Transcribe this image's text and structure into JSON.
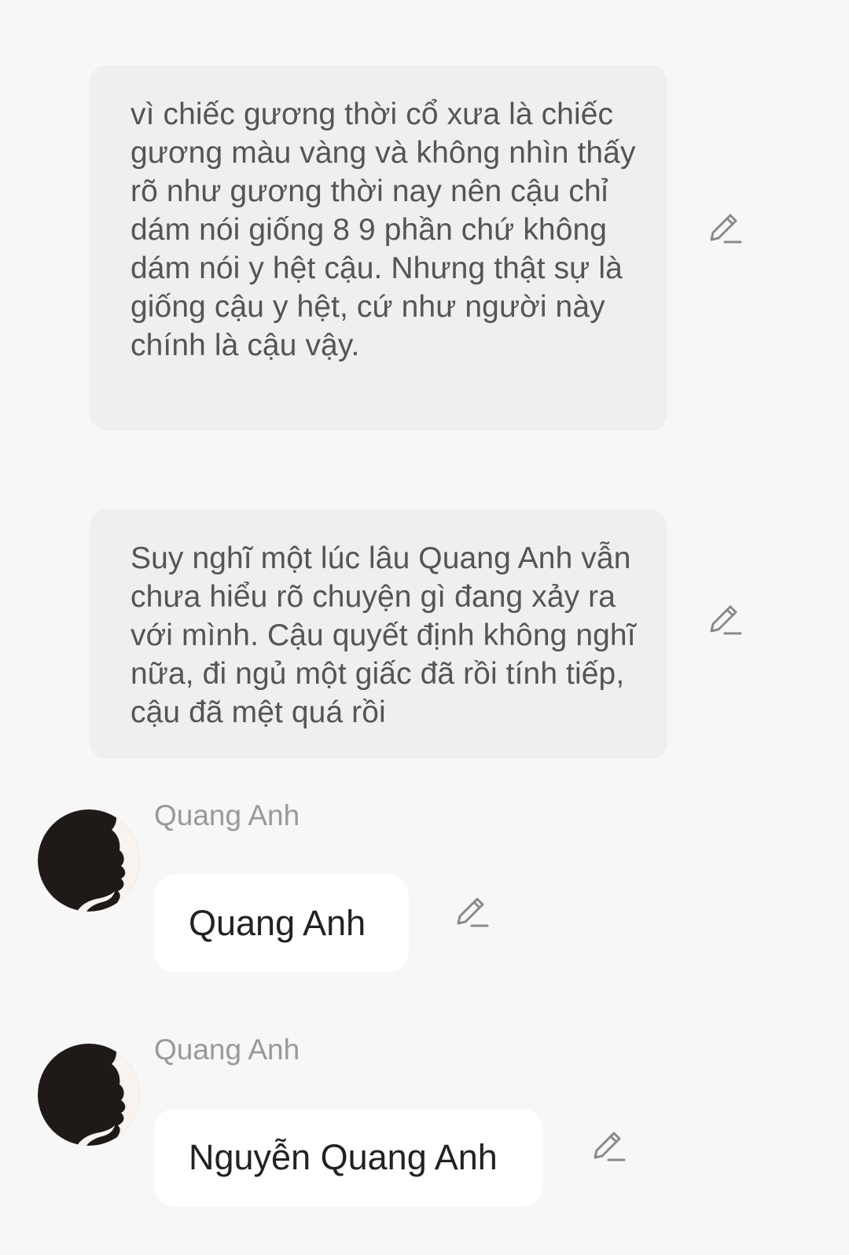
{
  "messages": [
    {
      "type": "narration",
      "text": "vì chiếc gương thời cổ xưa là chiếc gương màu vàng và không nhìn thấy rõ như gương thời nay nên cậu chỉ dám nói giống 8 9 phần chứ không dám nói y hệt cậu. Nhưng thật sự là giống cậu y hệt, cứ như người này chính là cậu vậy.",
      "edit_icon": "pencil-icon"
    },
    {
      "type": "narration",
      "text": "Suy nghĩ một lúc lâu Quang Anh vẫn chưa hiểu rõ chuyện gì đang xảy ra với mình. Cậu quyết định không nghĩ nữa, đi ngủ một giấc đã rồi tính tiếp, cậu đã mệt quá rồi",
      "edit_icon": "pencil-icon"
    },
    {
      "type": "speech",
      "speaker": "Quang Anh",
      "text": "Quang Anh",
      "avatar_icon": "silhouette-avatar",
      "edit_icon": "pencil-icon"
    },
    {
      "type": "speech",
      "speaker": "Quang Anh",
      "text": "Nguyễn Quang Anh",
      "avatar_icon": "silhouette-avatar",
      "edit_icon": "pencil-icon"
    }
  ],
  "colors": {
    "background": "#f7f7f7",
    "narration_bubble": "#efefef",
    "speech_bubble": "#ffffff",
    "narration_text": "#555555",
    "speech_text": "#222222",
    "speaker_name": "#999999",
    "icon": "#8a8a8a"
  }
}
